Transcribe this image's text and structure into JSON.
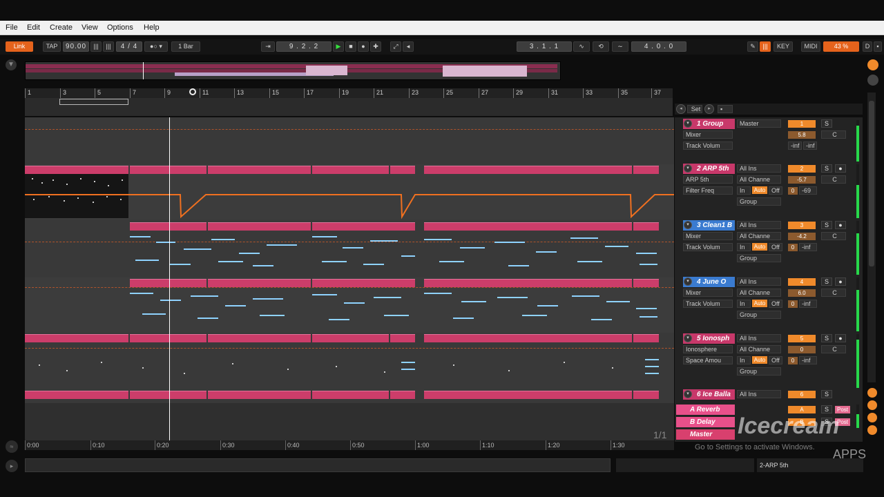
{
  "menu": [
    "File",
    "Edit",
    "Create",
    "View",
    "Options",
    "Help"
  ],
  "transport": {
    "link": "Link",
    "tap": "TAP",
    "tempo": "90.00",
    "meter": "4 / 4",
    "quantize": "1 Bar",
    "position": "9 . 2 . 2",
    "loop_start": "3 . 1 . 1",
    "loop_length": "4 . 0 . 0",
    "key": "KEY",
    "midi": "MIDI",
    "cpu": "43 %",
    "d": "D"
  },
  "ruler_bars": [
    "1",
    "3",
    "5",
    "7",
    "9",
    "11",
    "13",
    "15",
    "17",
    "19",
    "21",
    "23",
    "25",
    "27",
    "29",
    "31",
    "33",
    "35",
    "37"
  ],
  "time_marks": [
    "0:00",
    "0:10",
    "0:20",
    "0:30",
    "0:40",
    "0:50",
    "1:00",
    "1:10",
    "1:20",
    "1:30"
  ],
  "mixer": {
    "set_label": "Set",
    "tracks": [
      {
        "name": "1 Group",
        "input": "Master",
        "device": "Mixer",
        "param": "Track Volum",
        "number": "1",
        "s": "S",
        "vol": "5.8",
        "pan": "C",
        "sendA": "-inf",
        "sendB": "-inf",
        "color": "#c8386a"
      },
      {
        "name": "2 ARP 5th",
        "input": "All Ins",
        "channel": "All Channe",
        "device": "ARP 5th",
        "param": "Filter Freq",
        "number": "2",
        "s": "S",
        "vol": "-5.7",
        "pan": "C",
        "sendA": "0",
        "sendB": "-69",
        "monitor_in": "In",
        "monitor_auto": "Auto",
        "monitor_off": "Off",
        "output": "Group",
        "color": "#c8386a"
      },
      {
        "name": "3 Clean1 B",
        "input": "All Ins",
        "channel": "All Channe",
        "device": "Mixer",
        "param": "Track Volum",
        "number": "3",
        "s": "S",
        "vol": "-4.2",
        "pan": "C",
        "sendA": "0",
        "sendB": "-inf",
        "monitor_in": "In",
        "monitor_auto": "Auto",
        "monitor_off": "Off",
        "output": "Group",
        "color": "#3a7bd0"
      },
      {
        "name": "4 June O",
        "input": "All Ins",
        "channel": "All Channe",
        "device": "Mixer",
        "param": "Track Volum",
        "number": "4",
        "s": "S",
        "vol": "6.0",
        "pan": "C",
        "sendA": "0",
        "sendB": "-inf",
        "monitor_in": "In",
        "monitor_auto": "Auto",
        "monitor_off": "Off",
        "output": "Group",
        "color": "#3a7bd0"
      },
      {
        "name": "5 Ionosph",
        "input": "All Ins",
        "channel": "All Channe",
        "device": "Ionosphere",
        "param": "Space Amou",
        "number": "5",
        "s": "S",
        "vol": "0",
        "pan": "C",
        "sendA": "0",
        "sendB": "-inf",
        "monitor_in": "In",
        "monitor_auto": "Auto",
        "monitor_off": "Off",
        "output": "Group",
        "color": "#c8386a"
      },
      {
        "name": "6 Ice Balla",
        "input": "All Ins",
        "number": "6",
        "s": "S",
        "color": "#c8386a"
      }
    ],
    "returns": [
      {
        "name": "A Reverb",
        "number": "A",
        "s": "S",
        "post": "Post"
      },
      {
        "name": "B Delay",
        "number": "B",
        "s": "S",
        "post": "Post"
      },
      {
        "name": "Master",
        "number": "",
        "s": "",
        "post": ""
      }
    ]
  },
  "page_indicator": "1/1",
  "status_track": "2-ARP 5th",
  "watermark": {
    "brand": "Icecream",
    "sub": "APPS",
    "windows": "Go to Settings to activate Windows."
  }
}
